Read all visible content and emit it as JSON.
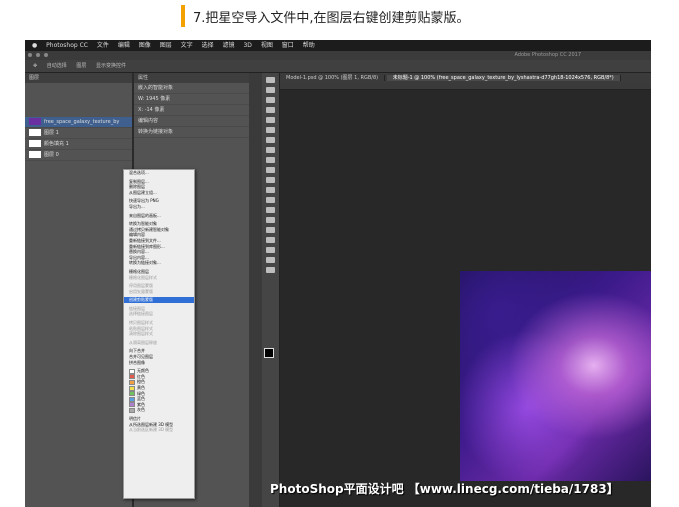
{
  "caption": {
    "text": "7.把星空导入文件中,在图层右键创建剪贴蒙版。"
  },
  "menubar": {
    "items": [
      "Photoshop CC",
      "文件",
      "编辑",
      "图像",
      "图层",
      "文字",
      "选择",
      "滤镜",
      "3D",
      "视图",
      "窗口",
      "帮助"
    ]
  },
  "titlebar": {
    "app": "Adobe Photoshop CC 2017"
  },
  "options": {
    "items": [
      "自动选择",
      "图层",
      "显示变换控件"
    ]
  },
  "layers_panel": {
    "header": "图层",
    "rows": [
      {
        "label": "free_space_galaxy_texture_by",
        "selected": true
      },
      {
        "label": "图层 1",
        "selected": false
      },
      {
        "label": "颜色填充 1",
        "selected": false
      },
      {
        "label": "图层 0",
        "selected": false
      }
    ]
  },
  "properties_panel": {
    "header": "属性",
    "rows": [
      "嵌入的智能对象",
      "W: 1945 像素",
      "X: -14 像素",
      "编辑内容",
      "转换为链接对象"
    ]
  },
  "tabs": [
    {
      "label": "Model-1.psd @ 100% (图层 1, RGB/8)",
      "active": false
    },
    {
      "label": "未标题-1 @ 100% (free_space_galaxy_texture_by_lyshastra-d77gh18-1024x576, RGB/8*)",
      "active": true
    }
  ],
  "context_menu": {
    "items": [
      {
        "label": "混合选项...",
        "state": "normal"
      },
      {
        "label": "复制图层...",
        "state": "normal"
      },
      {
        "label": "删除图层",
        "state": "normal"
      },
      {
        "label": "从图层建立组...",
        "state": "normal"
      },
      {
        "label": "快速导出为 PNG",
        "state": "normal"
      },
      {
        "label": "导出为...",
        "state": "normal"
      },
      {
        "label": "来自图层的画板...",
        "state": "normal"
      },
      {
        "label": "转换为智能对象",
        "state": "normal"
      },
      {
        "label": "通过拷贝新建智能对象",
        "state": "normal"
      },
      {
        "label": "编辑内容",
        "state": "normal"
      },
      {
        "label": "重新链接到文件...",
        "state": "normal"
      },
      {
        "label": "重新链接到库图形...",
        "state": "normal"
      },
      {
        "label": "替换内容...",
        "state": "normal"
      },
      {
        "label": "导出内容...",
        "state": "normal"
      },
      {
        "label": "转换为链接对象...",
        "state": "normal"
      },
      {
        "label": "栅格化图层",
        "state": "normal"
      },
      {
        "label": "栅格化图层样式",
        "state": "disabled"
      },
      {
        "label": "停用图层蒙版",
        "state": "disabled"
      },
      {
        "label": "启用矢量蒙版",
        "state": "disabled"
      },
      {
        "label": "创建剪贴蒙版",
        "state": "highlighted"
      },
      {
        "label": "链接图层",
        "state": "disabled"
      },
      {
        "label": "选择链接图层",
        "state": "disabled"
      },
      {
        "label": "拷贝图层样式",
        "state": "disabled"
      },
      {
        "label": "粘贴图层样式",
        "state": "disabled"
      },
      {
        "label": "清除图层样式",
        "state": "disabled"
      },
      {
        "label": "从隔离图层释放",
        "state": "disabled"
      },
      {
        "label": "向下合并",
        "state": "normal"
      },
      {
        "label": "合并可见图层",
        "state": "normal"
      },
      {
        "label": "拼合图像",
        "state": "normal"
      },
      {
        "label": "无颜色",
        "state": "color",
        "color": "#ffffff"
      },
      {
        "label": "红色",
        "state": "color",
        "color": "#e05a4e"
      },
      {
        "label": "橙色",
        "state": "color",
        "color": "#f0a040"
      },
      {
        "label": "黄色",
        "state": "color",
        "color": "#f0e050"
      },
      {
        "label": "绿色",
        "state": "color",
        "color": "#70c060"
      },
      {
        "label": "蓝色",
        "state": "color",
        "color": "#5aa0e0"
      },
      {
        "label": "紫色",
        "state": "color",
        "color": "#b080d0"
      },
      {
        "label": "灰色",
        "state": "color",
        "color": "#aaaaaa"
      },
      {
        "label": "明信片",
        "state": "normal"
      },
      {
        "label": "从所选图层新建 3D 模型",
        "state": "normal"
      },
      {
        "label": "从当前选区新建 3D 模型",
        "state": "disabled"
      }
    ]
  },
  "watermark": {
    "text": "PhotoShop平面设计吧 【www.linecg.com/tieba/1783】"
  }
}
